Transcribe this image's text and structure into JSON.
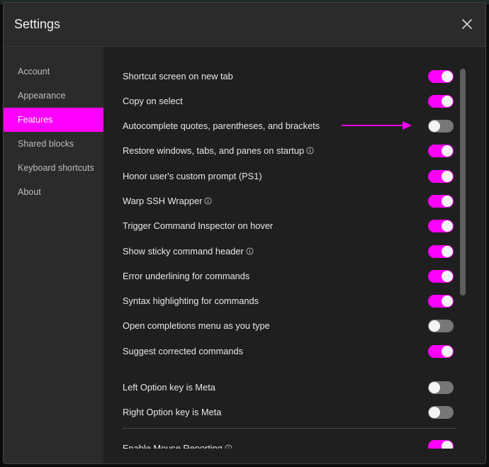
{
  "window": {
    "title": "Settings"
  },
  "sidebar": {
    "items": [
      {
        "label": "Account",
        "active": false
      },
      {
        "label": "Appearance",
        "active": false
      },
      {
        "label": "Features",
        "active": true
      },
      {
        "label": "Shared blocks",
        "active": false
      },
      {
        "label": "Keyboard shortcuts",
        "active": false
      },
      {
        "label": "About",
        "active": false
      }
    ]
  },
  "features": {
    "rows": [
      {
        "label": "Shortcut screen on new tab",
        "enabled": true,
        "info": false
      },
      {
        "label": "Copy on select",
        "enabled": true,
        "info": false
      },
      {
        "label": "Autocomplete quotes, parentheses, and brackets",
        "enabled": false,
        "info": false
      },
      {
        "label": "Restore windows, tabs, and panes on startup",
        "enabled": true,
        "info": true
      },
      {
        "label": "Honor user's custom prompt (PS1)",
        "enabled": true,
        "info": false
      },
      {
        "label": "Warp SSH Wrapper",
        "enabled": true,
        "info": true
      },
      {
        "label": "Trigger Command Inspector on hover",
        "enabled": true,
        "info": false
      },
      {
        "label": "Show sticky command header",
        "enabled": true,
        "info": true
      },
      {
        "label": "Error underlining for commands",
        "enabled": true,
        "info": false
      },
      {
        "label": "Syntax highlighting for commands",
        "enabled": true,
        "info": false
      },
      {
        "label": "Open completions menu as you type",
        "enabled": false,
        "info": false
      },
      {
        "label": "Suggest corrected commands",
        "enabled": true,
        "info": false
      }
    ],
    "key_rows": [
      {
        "label": "Left Option key is Meta",
        "enabled": false
      },
      {
        "label": "Right Option key is Meta",
        "enabled": false
      }
    ],
    "partial_row": {
      "label": "Enable Mouse Reporting",
      "enabled": true
    }
  },
  "colors": {
    "accent": "#ff00ff",
    "toggle_off": "#777777",
    "panel": "#1f1f1f",
    "sidebar": "#2b2b2b"
  },
  "icons": {
    "close": "close-icon",
    "info": "info-icon",
    "annotation": "arrow-right-icon"
  }
}
